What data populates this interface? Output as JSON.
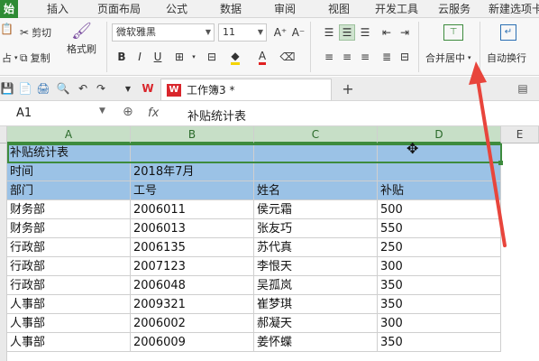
{
  "tabs": [
    "始",
    "插入",
    "页面布局",
    "公式",
    "数据",
    "审阅",
    "视图",
    "开发工具",
    "云服务",
    "新建选项卡"
  ],
  "ribbon": {
    "paste_fragment": "占",
    "cut": "剪切",
    "copy": "复制",
    "format_painter": "格式刷",
    "font_name": "微软雅黑",
    "font_size": "11",
    "merge_center": "合并居中",
    "wrap_text": "自动换行"
  },
  "document": {
    "tab_title": "工作簿3 *",
    "logo": "W",
    "add_tab": "+"
  },
  "formula_bar": {
    "cell_ref": "A1",
    "fx": "fx",
    "content": "补贴统计表"
  },
  "columns": [
    "A",
    "B",
    "C",
    "D",
    "E"
  ],
  "rows": [
    [
      "补贴统计表",
      "",
      "",
      ""
    ],
    [
      "时间",
      "2018年7月",
      "",
      ""
    ],
    [
      "部门",
      "工号",
      "姓名",
      "补贴"
    ],
    [
      "财务部",
      "2006011",
      "侯元霜",
      "500"
    ],
    [
      "财务部",
      "2006013",
      "张友巧",
      "550"
    ],
    [
      "行政部",
      "2006135",
      "苏代真",
      "250"
    ],
    [
      "行政部",
      "2007123",
      "李恨天",
      "300"
    ],
    [
      "行政部",
      "2006048",
      "吴孤岚",
      "350"
    ],
    [
      "人事部",
      "2009321",
      "崔梦琪",
      "350"
    ],
    [
      "人事部",
      "2006002",
      "郝凝天",
      "300"
    ],
    [
      "人事部",
      "2006009",
      "姜怀蝶",
      "350"
    ]
  ],
  "colors": {
    "header_fill": "#9bc2e6",
    "selection_border": "#3d8b3d",
    "annotation_arrow": "#e8453c",
    "active_tab": "#2e8b34"
  }
}
